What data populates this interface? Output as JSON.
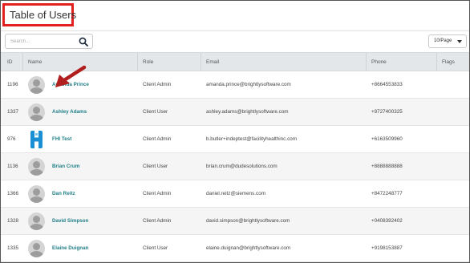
{
  "page": {
    "title": "Table of Users"
  },
  "search": {
    "placeholder": "Search..."
  },
  "pagination": {
    "page_size": "10/Page"
  },
  "table": {
    "columns": [
      "ID",
      "Name",
      "Role",
      "Email",
      "Phone",
      "Flags"
    ],
    "rows": [
      {
        "id": "1196",
        "name": "Amanda Prince",
        "role": "Client Admin",
        "email": "amanda.prince@brightlysoftware.com",
        "phone": "+8664553833",
        "flags": "",
        "avatar": "person-icon"
      },
      {
        "id": "1337",
        "name": "Ashley Adams",
        "role": "Client User",
        "email": "ashley.adams@brightlysoftware.com",
        "phone": "+9727400325",
        "flags": "",
        "avatar": "person-icon"
      },
      {
        "id": "976",
        "name": "FHI Test",
        "role": "Client Admin",
        "email": "b.butler+indeptest@facilityhealthinc.com",
        "phone": "+6163509960",
        "flags": "",
        "avatar": "company-logo-icon"
      },
      {
        "id": "1136",
        "name": "Brian Crum",
        "role": "Client User",
        "email": "brian.crum@dudesolutions.com",
        "phone": "+8888888888",
        "flags": "",
        "avatar": "person-icon"
      },
      {
        "id": "1366",
        "name": "Dan Reitz",
        "role": "Client Admin",
        "email": "daniel.reitz@siemens.com",
        "phone": "+8472248777",
        "flags": "",
        "avatar": "person-icon"
      },
      {
        "id": "1328",
        "name": "David Simpson",
        "role": "Client Admin",
        "email": "david.simpson@brightlysoftware.com",
        "phone": "+0408392402",
        "flags": "",
        "avatar": "person-icon"
      },
      {
        "id": "1335",
        "name": "Elaine Duignan",
        "role": "Client User",
        "email": "elaine.duignan@brightlysoftware.com",
        "phone": "+9198153887",
        "flags": "",
        "avatar": "person-icon"
      }
    ]
  },
  "colors": {
    "highlight": "#e32020",
    "arrow": "#b01e1e",
    "link": "#1f7f87",
    "logo": "#1a8fd6"
  }
}
